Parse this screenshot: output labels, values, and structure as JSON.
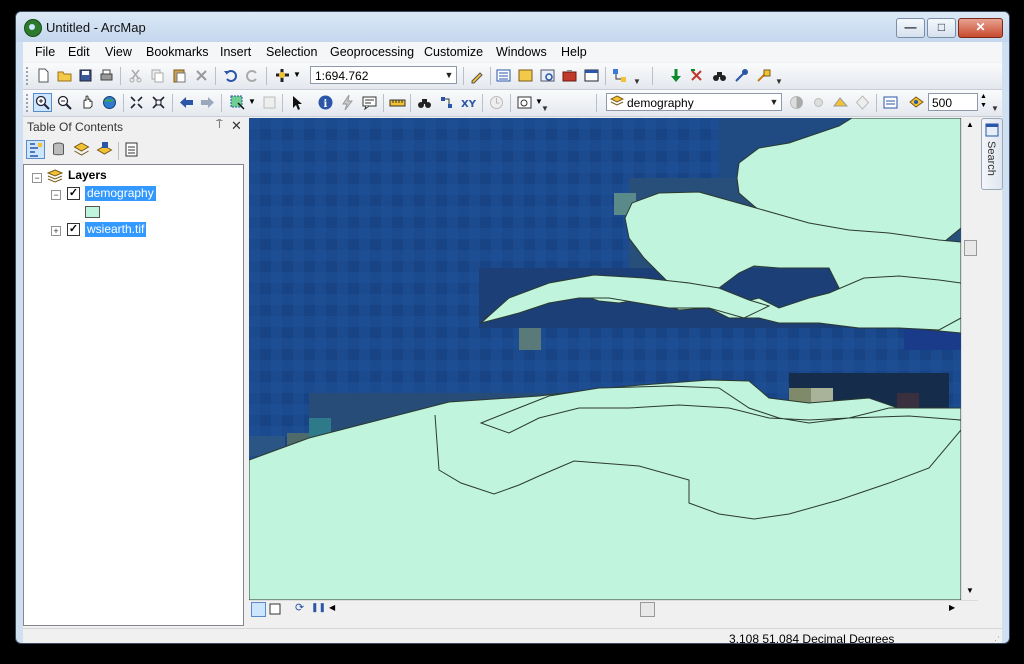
{
  "window": {
    "title": "Untitled - ArcMap",
    "minimize": "—",
    "maximize": "□",
    "close": "✕"
  },
  "menu": [
    "File",
    "Edit",
    "View",
    "Bookmarks",
    "Insert",
    "Selection",
    "Geoprocessing",
    "Customize",
    "Windows",
    "Help"
  ],
  "toolbar": {
    "scale": "1:694.762",
    "layer_combo": "demography",
    "snap_tolerance": "500"
  },
  "toc": {
    "title": "Table Of Contents",
    "pin": "⍑",
    "close": "✕",
    "root": "Layers",
    "layers": [
      {
        "name": "demography",
        "checked": "✓",
        "expand": "−",
        "swatch": "#bff5dc"
      },
      {
        "name": "wsiearth.tif",
        "checked": "✓",
        "expand": "+"
      }
    ]
  },
  "search_tab": "Search",
  "status": {
    "coords": "3,108  51,084 Decimal Degrees"
  },
  "colors": {
    "water": "#1b4a8f",
    "land_polygon": "#c0f4dc",
    "selection": "#3399ff"
  }
}
